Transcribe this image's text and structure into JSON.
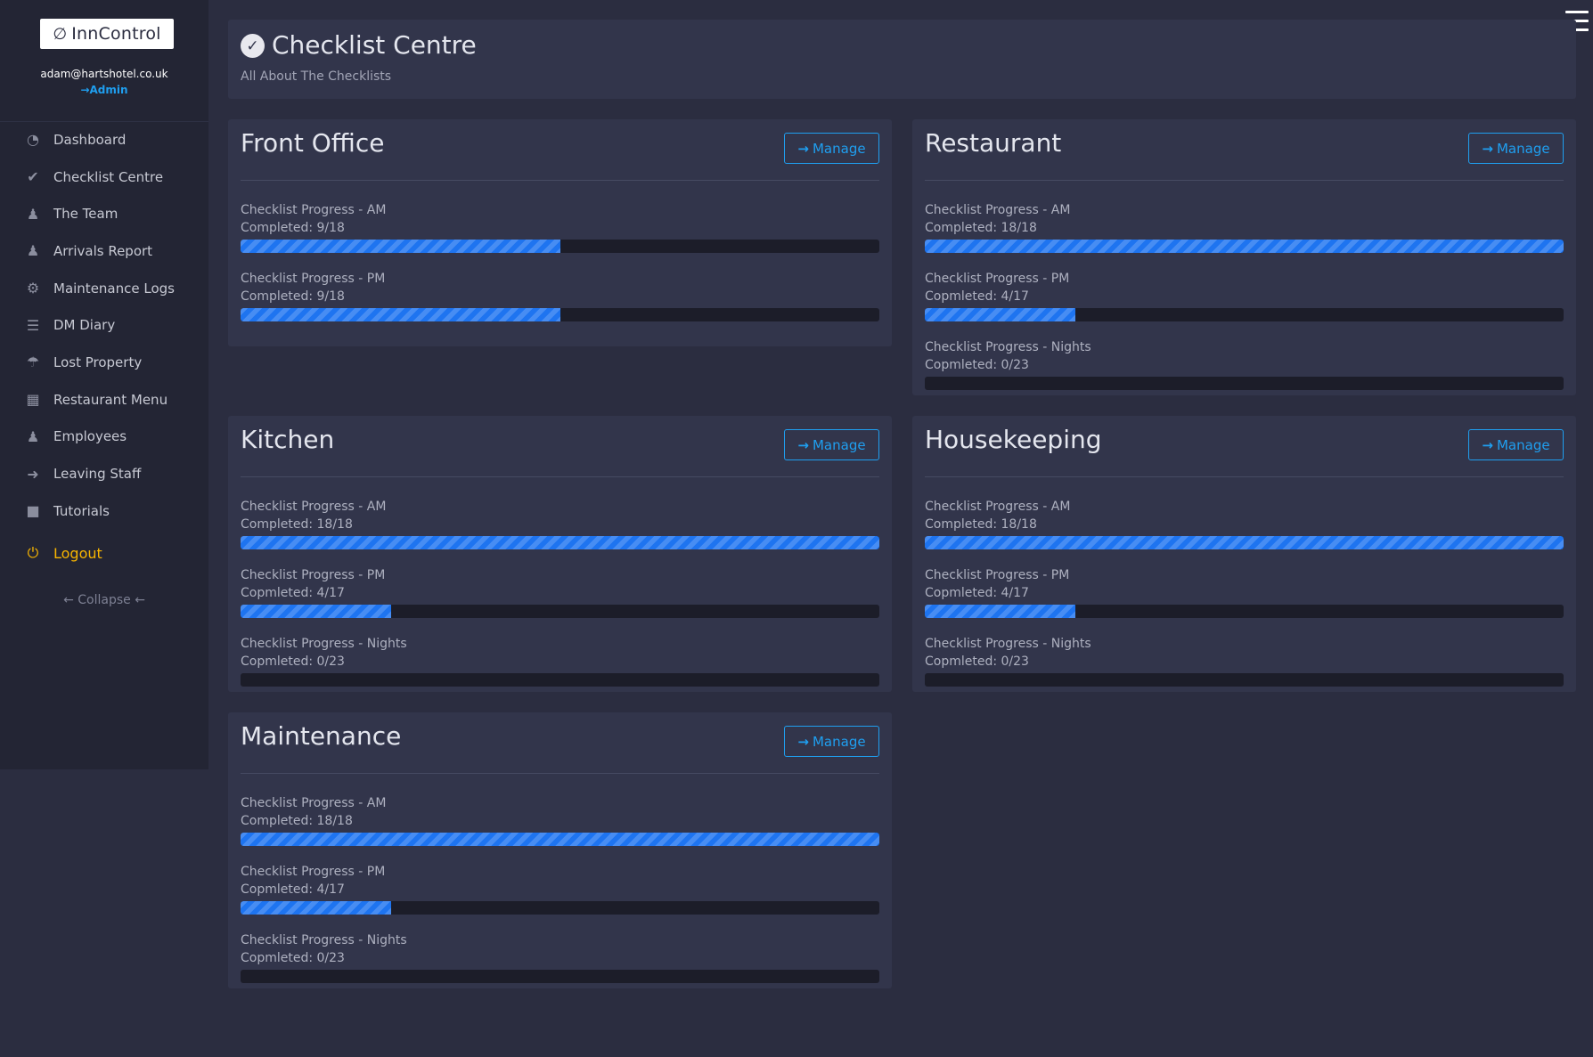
{
  "app": {
    "brand": "InnControl",
    "user_email": "adam@hartshotel.co.uk",
    "user_role": "Admin"
  },
  "sidebar": {
    "items": [
      {
        "label": "Dashboard",
        "icon": "dashboard-icon"
      },
      {
        "label": "Checklist Centre",
        "icon": "check-circle-icon"
      },
      {
        "label": "The Team",
        "icon": "users-icon"
      },
      {
        "label": "Arrivals Report",
        "icon": "users-icon"
      },
      {
        "label": "Maintenance Logs",
        "icon": "cogs-icon"
      },
      {
        "label": "DM Diary",
        "icon": "list-icon"
      },
      {
        "label": "Lost Property",
        "icon": "parachute-icon"
      },
      {
        "label": "Restaurant Menu",
        "icon": "book-icon"
      },
      {
        "label": "Employees",
        "icon": "users-icon"
      },
      {
        "label": "Leaving Staff",
        "icon": "walking-icon"
      },
      {
        "label": "Tutorials",
        "icon": "tutorial-book-icon"
      }
    ],
    "logout_label": "Logout",
    "collapse_label": "Collapse"
  },
  "header": {
    "title": "Checklist Centre",
    "subtitle": "All About The Checklists"
  },
  "manage_label": "Manage",
  "departments": [
    {
      "name": "Front Office",
      "progress": [
        {
          "label": "Checklist Progress - AM",
          "count_text": "Completed: 9/18",
          "fraction": 0.5
        },
        {
          "label": "Checklist Progress - PM",
          "count_text": "Completed: 9/18",
          "fraction": 0.5
        }
      ]
    },
    {
      "name": "Restaurant",
      "progress": [
        {
          "label": "Checklist Progress - AM",
          "count_text": "Completed: 18/18",
          "fraction": 1.0
        },
        {
          "label": "Checklist Progress - PM",
          "count_text": "Copmleted: 4/17",
          "fraction": 0.2353
        },
        {
          "label": "Checklist Progress - Nights",
          "count_text": "Copmleted: 0/23",
          "fraction": 0.0
        }
      ]
    },
    {
      "name": "Kitchen",
      "progress": [
        {
          "label": "Checklist Progress - AM",
          "count_text": "Completed: 18/18",
          "fraction": 1.0
        },
        {
          "label": "Checklist Progress - PM",
          "count_text": "Copmleted: 4/17",
          "fraction": 0.2353
        },
        {
          "label": "Checklist Progress - Nights",
          "count_text": "Copmleted: 0/23",
          "fraction": 0.0
        }
      ]
    },
    {
      "name": "Housekeeping",
      "progress": [
        {
          "label": "Checklist Progress - AM",
          "count_text": "Completed: 18/18",
          "fraction": 1.0
        },
        {
          "label": "Checklist Progress - PM",
          "count_text": "Copmleted: 4/17",
          "fraction": 0.2353
        },
        {
          "label": "Checklist Progress - Nights",
          "count_text": "Copmleted: 0/23",
          "fraction": 0.0
        }
      ]
    },
    {
      "name": "Maintenance",
      "progress": [
        {
          "label": "Checklist Progress - AM",
          "count_text": "Completed: 18/18",
          "fraction": 1.0
        },
        {
          "label": "Checklist Progress - PM",
          "count_text": "Copmleted: 4/17",
          "fraction": 0.2353
        },
        {
          "label": "Checklist Progress - Nights",
          "count_text": "Copmleted: 0/23",
          "fraction": 0.0
        }
      ]
    }
  ],
  "colors": {
    "accent": "#1f9ff0",
    "progress_fill": "#1e74f0",
    "logout": "#f7b500",
    "background": "#2b2d40",
    "card": "#32354b",
    "sidebar": "#232534"
  }
}
